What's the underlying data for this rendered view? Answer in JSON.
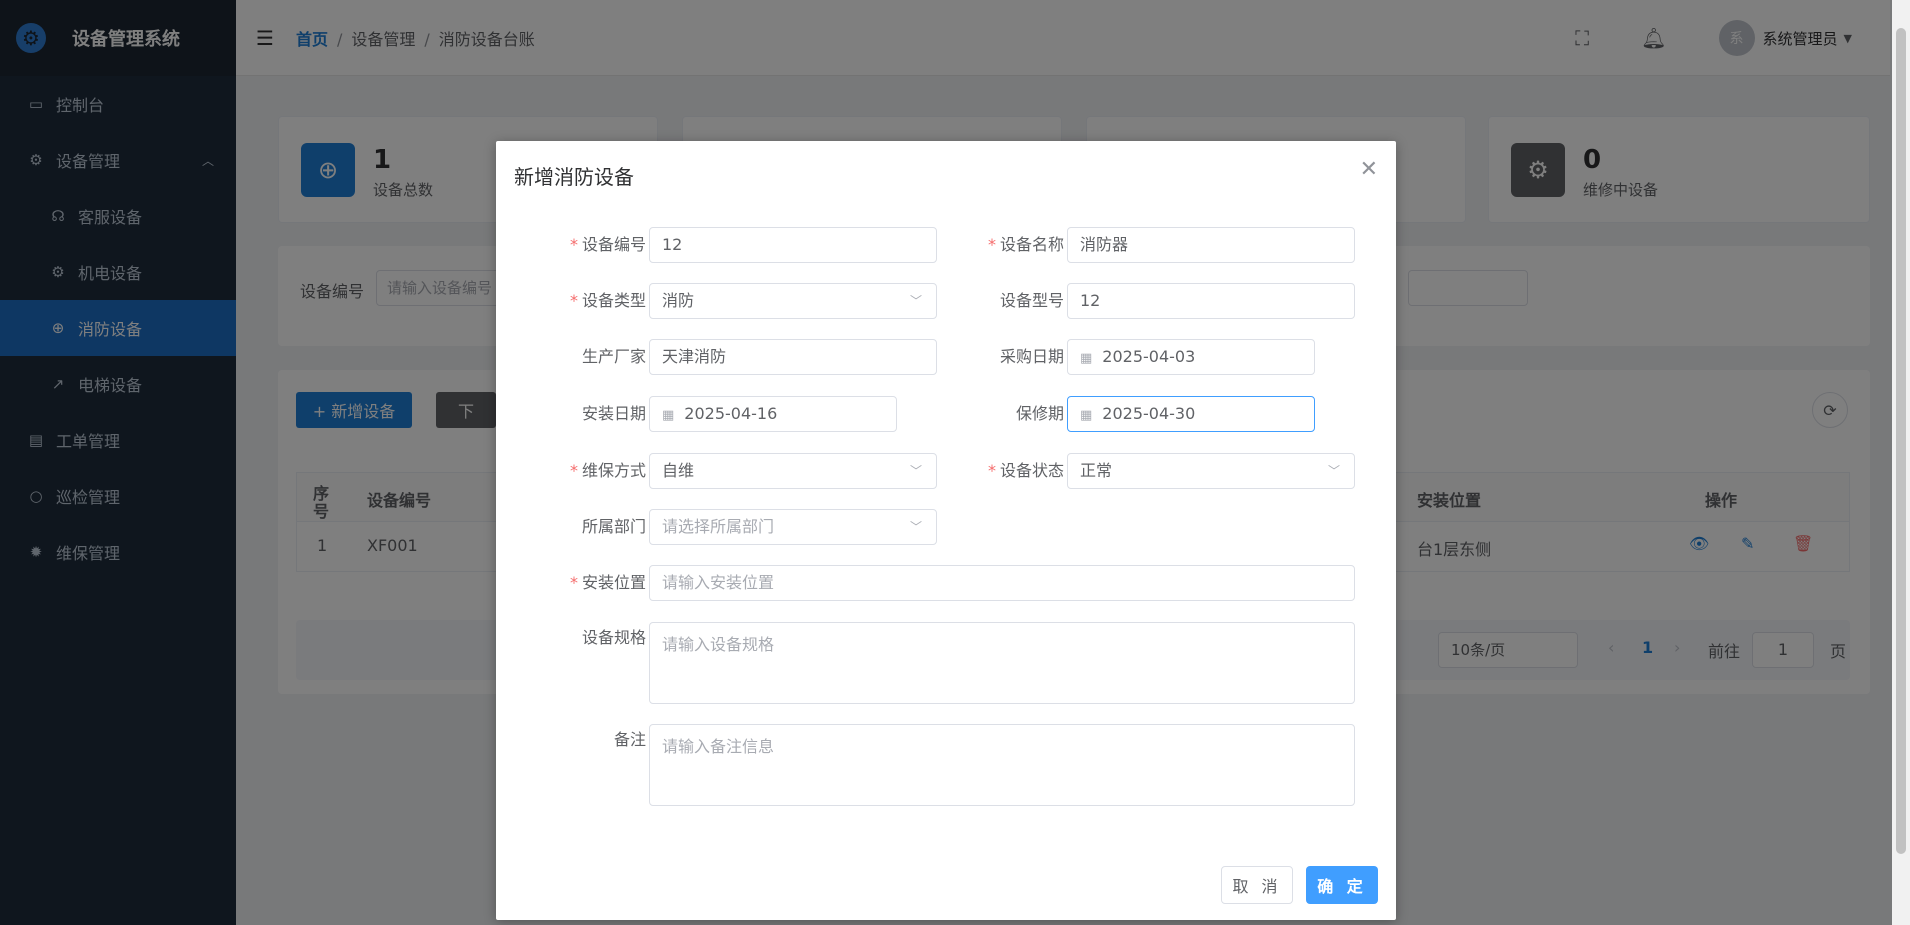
{
  "app": {
    "title": "设备管理系统"
  },
  "sidebar": {
    "items": [
      {
        "label": "控制台",
        "icon": "monitor-icon"
      },
      {
        "label": "设备管理",
        "icon": "gear-icon"
      },
      {
        "label": "客服设备",
        "icon": "headset-icon"
      },
      {
        "label": "机电设备",
        "icon": "gear-icon"
      },
      {
        "label": "消防设备",
        "icon": "target-icon"
      },
      {
        "label": "电梯设备",
        "icon": "arrow-up-right-icon"
      },
      {
        "label": "工单管理",
        "icon": "document-icon"
      },
      {
        "label": "巡检管理",
        "icon": "search-icon"
      },
      {
        "label": "维保管理",
        "icon": "gear-filled-icon"
      }
    ]
  },
  "header": {
    "breadcrumb": [
      "首页",
      "设备管理",
      "消防设备台账"
    ],
    "user": "系统管理员",
    "avatar_char": "系"
  },
  "stats": [
    {
      "value": "1",
      "label": "设备总数",
      "color": "#1f7fd6"
    },
    {
      "value": "0",
      "label": "维修中设备",
      "color": "#606266"
    }
  ],
  "toolbar": {
    "add_label": "+ 新增设备",
    "download_label": "下"
  },
  "filter": {
    "label": "设备编号",
    "placeholder": "请输入设备编号"
  },
  "table": {
    "headers": [
      "序号",
      "设备编号",
      "安装位置",
      "操作"
    ],
    "rows": [
      {
        "index": "1",
        "code": "XF001",
        "location": "台1层东侧"
      }
    ]
  },
  "pagination": {
    "page_size": "10条/页",
    "current": "1",
    "goto_label": "前往",
    "goto_value": "1",
    "page_suffix": "页"
  },
  "modal": {
    "title": "新增消防设备",
    "fields": {
      "code": {
        "label": "设备编号",
        "value": "12"
      },
      "name": {
        "label": "设备名称",
        "value": "消防器"
      },
      "type": {
        "label": "设备类型",
        "value": "消防"
      },
      "model": {
        "label": "设备型号",
        "value": "12"
      },
      "maker": {
        "label": "生产厂家",
        "value": "天津消防"
      },
      "purchase": {
        "label": "采购日期",
        "value": "2025-04-03"
      },
      "install": {
        "label": "安装日期",
        "value": "2025-04-16"
      },
      "warranty": {
        "label": "保修期",
        "value": "2025-04-30"
      },
      "maint": {
        "label": "维保方式",
        "value": "自维"
      },
      "status": {
        "label": "设备状态",
        "value": "正常"
      },
      "dept": {
        "label": "所属部门",
        "placeholder": "请选择所属部门"
      },
      "location": {
        "label": "安装位置",
        "placeholder": "请输入安装位置"
      },
      "spec": {
        "label": "设备规格",
        "placeholder": "请输入设备规格"
      },
      "remark": {
        "label": "备注",
        "placeholder": "请输入备注信息"
      }
    },
    "cancel_label": "取 消",
    "ok_label": "确 定"
  }
}
